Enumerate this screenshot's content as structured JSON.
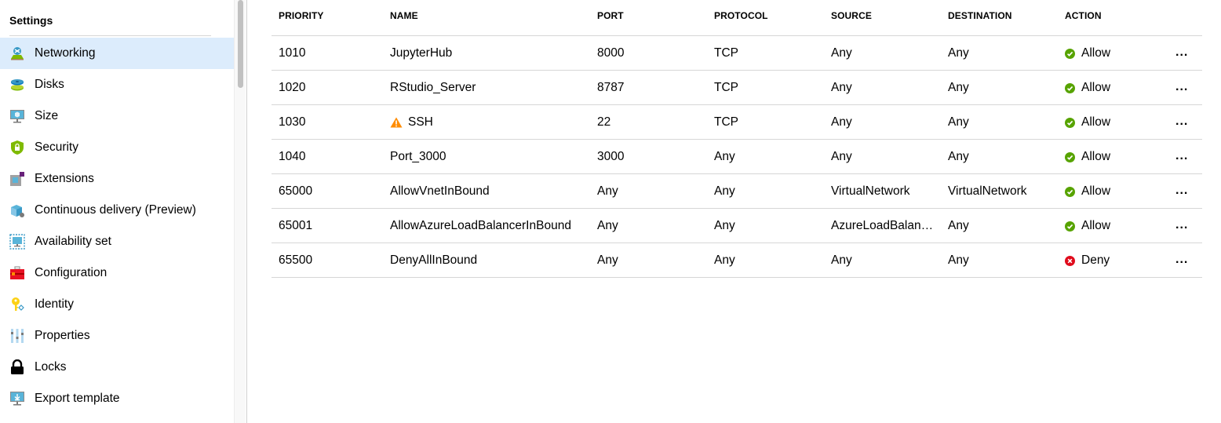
{
  "sidebar": {
    "heading": "Settings",
    "items": [
      {
        "label": "Networking",
        "icon": "networking-icon",
        "selected": true
      },
      {
        "label": "Disks",
        "icon": "disks-icon",
        "selected": false
      },
      {
        "label": "Size",
        "icon": "size-icon",
        "selected": false
      },
      {
        "label": "Security",
        "icon": "security-shield-icon",
        "selected": false
      },
      {
        "label": "Extensions",
        "icon": "extensions-icon",
        "selected": false
      },
      {
        "label": "Continuous delivery (Preview)",
        "icon": "continuous-delivery-icon",
        "selected": false
      },
      {
        "label": "Availability set",
        "icon": "availability-set-icon",
        "selected": false
      },
      {
        "label": "Configuration",
        "icon": "configuration-toolbox-icon",
        "selected": false
      },
      {
        "label": "Identity",
        "icon": "identity-key-icon",
        "selected": false
      },
      {
        "label": "Properties",
        "icon": "properties-sliders-icon",
        "selected": false
      },
      {
        "label": "Locks",
        "icon": "lock-icon",
        "selected": false
      },
      {
        "label": "Export template",
        "icon": "export-template-icon",
        "selected": false
      }
    ]
  },
  "table": {
    "headers": {
      "priority": "PRIORITY",
      "name": "NAME",
      "port": "PORT",
      "protocol": "PROTOCOL",
      "source": "SOURCE",
      "destination": "DESTINATION",
      "action": "ACTION"
    },
    "more_label": "...",
    "rows": [
      {
        "priority": "1010",
        "name": "JupyterHub",
        "warning": false,
        "port": "8000",
        "protocol": "TCP",
        "source": "Any",
        "destination": "Any",
        "action": "Allow"
      },
      {
        "priority": "1020",
        "name": "RStudio_Server",
        "warning": false,
        "port": "8787",
        "protocol": "TCP",
        "source": "Any",
        "destination": "Any",
        "action": "Allow"
      },
      {
        "priority": "1030",
        "name": "SSH",
        "warning": true,
        "port": "22",
        "protocol": "TCP",
        "source": "Any",
        "destination": "Any",
        "action": "Allow"
      },
      {
        "priority": "1040",
        "name": "Port_3000",
        "warning": false,
        "port": "3000",
        "protocol": "Any",
        "source": "Any",
        "destination": "Any",
        "action": "Allow"
      },
      {
        "priority": "65000",
        "name": "AllowVnetInBound",
        "warning": false,
        "port": "Any",
        "protocol": "Any",
        "source": "VirtualNetwork",
        "destination": "VirtualNetwork",
        "action": "Allow"
      },
      {
        "priority": "65001",
        "name": "AllowAzureLoadBalancerInBound",
        "warning": false,
        "port": "Any",
        "protocol": "Any",
        "source": "AzureLoadBalancer",
        "destination": "Any",
        "action": "Allow"
      },
      {
        "priority": "65500",
        "name": "DenyAllInBound",
        "warning": false,
        "port": "Any",
        "protocol": "Any",
        "source": "Any",
        "destination": "Any",
        "action": "Deny"
      }
    ]
  },
  "colors": {
    "allow": "#57a300",
    "deny": "#e00b1c",
    "warning": "#ff8c00",
    "selected_bg": "#dcecfc"
  }
}
